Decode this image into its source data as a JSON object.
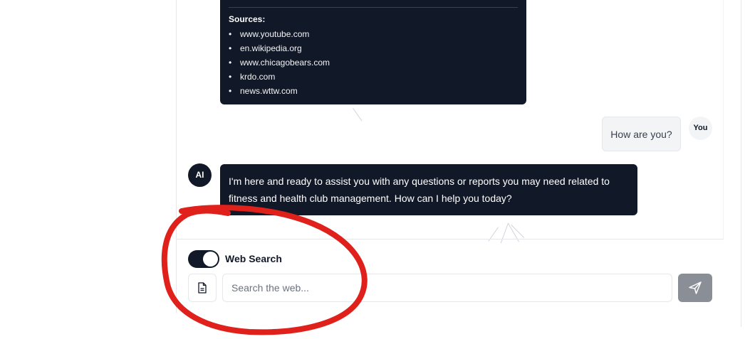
{
  "chat": {
    "sources": {
      "title": "Sources:",
      "items": [
        "www.youtube.com",
        "en.wikipedia.org",
        "www.chicagobears.com",
        "krdo.com",
        "news.wttw.com"
      ]
    },
    "user_message": "How are you?",
    "user_avatar": "You",
    "ai_avatar": "AI",
    "ai_message": "I'm here and ready to assist you with any questions or reports you may need related to fitness and health club management. How can I help you today?"
  },
  "composer": {
    "web_search_label": "Web Search",
    "web_search_on": true,
    "placeholder": "Search the web...",
    "value": "",
    "file_icon": "file-icon",
    "send_icon": "send-icon"
  },
  "colors": {
    "dark": "#111827",
    "annotation": "#e0201a",
    "send_disabled": "#8a8f97"
  }
}
